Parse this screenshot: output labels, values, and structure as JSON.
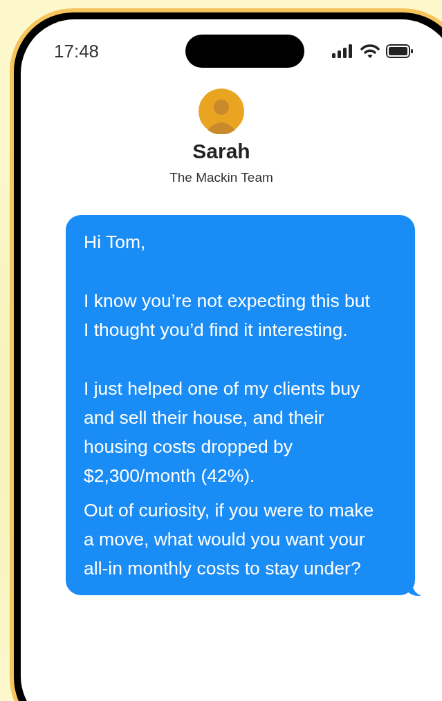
{
  "status_bar": {
    "time": "17:48"
  },
  "contact": {
    "name": "Sarah",
    "subtitle": "The Mackin Team"
  },
  "message": {
    "paragraphs": [
      "Hi Tom,",
      "I know you’re not expecting this but I thought you’d find it interesting.",
      "I just helped one of my clients buy and sell their house, and their housing costs dropped by $2,300/month (42%).",
      "Out of curiosity, if you were to make a move, what would you want your all-in monthly costs to stay under?"
    ]
  }
}
